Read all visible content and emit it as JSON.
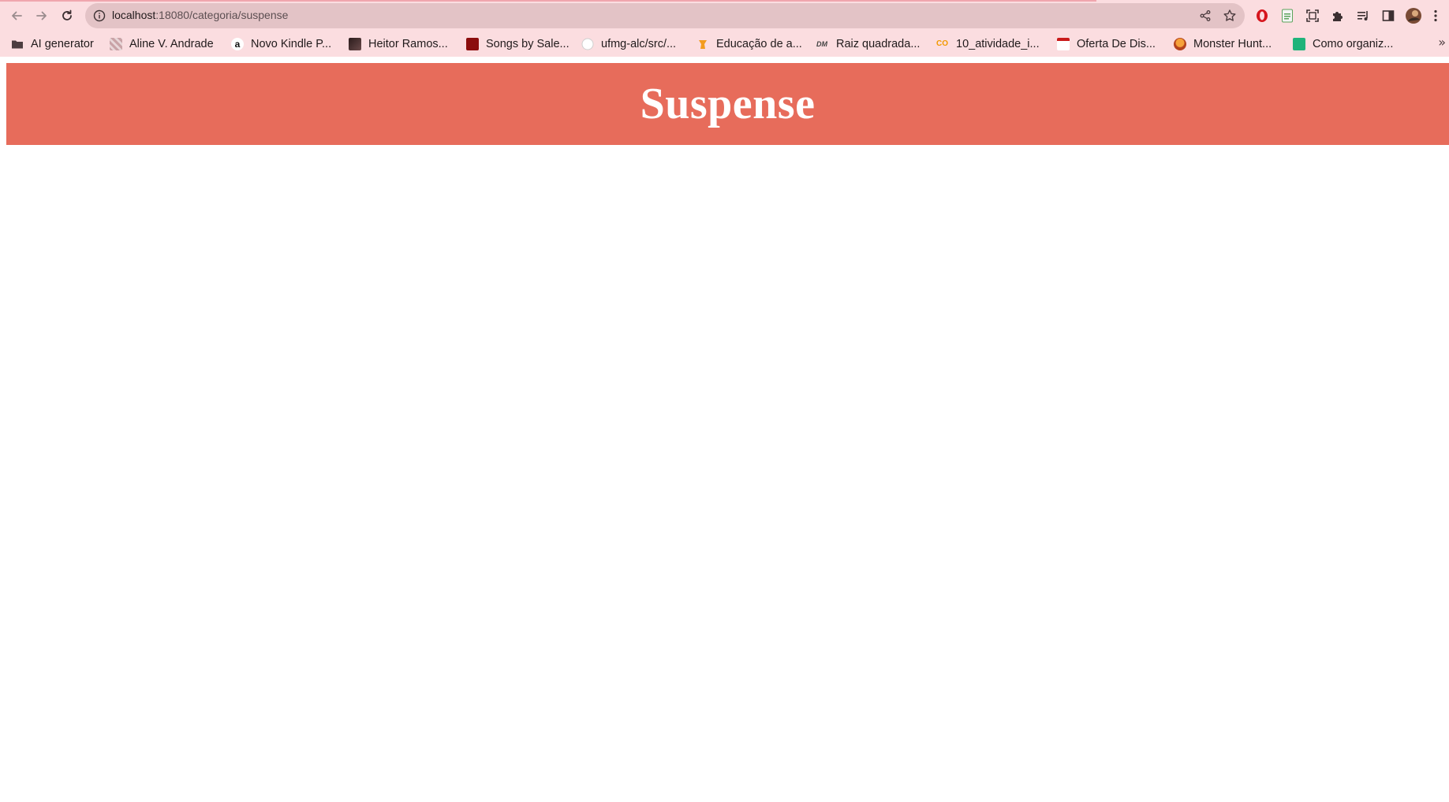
{
  "browser": {
    "url_host": "localhost",
    "url_path": ":18080/categoria/suspense",
    "bookmarks": [
      {
        "label": "AI generator",
        "icon": "folder-icon"
      },
      {
        "label": "Aline V. Andrade",
        "icon": "site-favicon"
      },
      {
        "label": "Novo Kindle P...",
        "icon": "amazon-icon"
      },
      {
        "label": "Heitor Ramos...",
        "icon": "site-favicon"
      },
      {
        "label": "Songs by Sale...",
        "icon": "site-favicon"
      },
      {
        "label": "ufmg-alc/src/...",
        "icon": "github-icon"
      },
      {
        "label": "Educação de a...",
        "icon": "site-favicon"
      },
      {
        "label": "Raiz quadrada...",
        "icon": "site-favicon"
      },
      {
        "label": "10_atividade_i...",
        "icon": "colab-icon"
      },
      {
        "label": "Oferta De Dis...",
        "icon": "site-favicon"
      },
      {
        "label": "Monster Hunt...",
        "icon": "site-favicon"
      },
      {
        "label": "Como organiz...",
        "icon": "site-favicon"
      }
    ],
    "more_bookmarks": "»"
  },
  "page": {
    "title": "Suspense",
    "header_color": "#e76c5b"
  }
}
